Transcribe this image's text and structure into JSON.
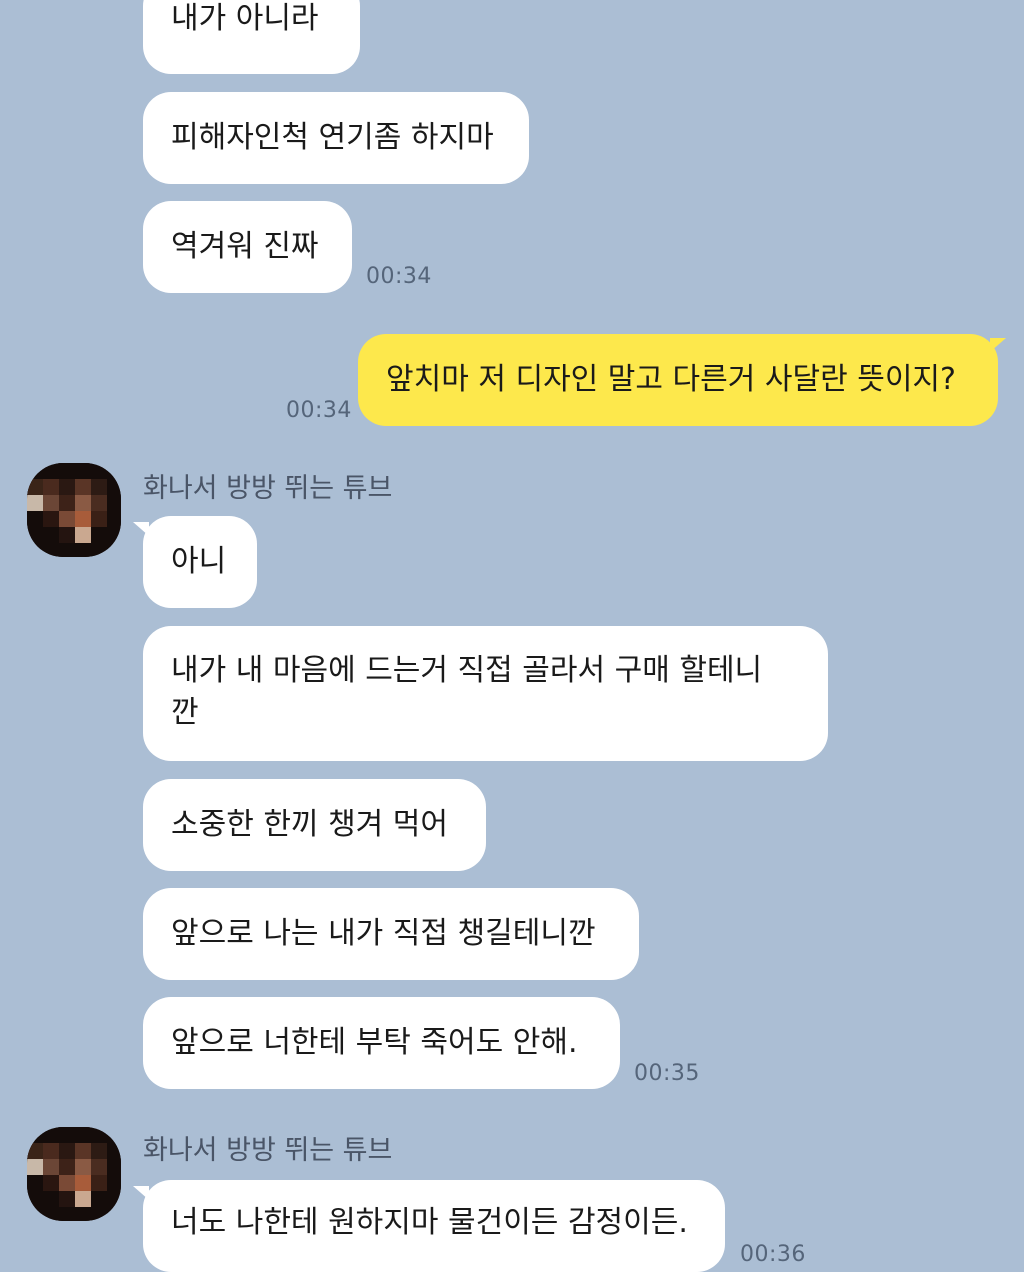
{
  "colors": {
    "background": "#abbed4",
    "incoming_bubble": "#ffffff",
    "outgoing_bubble": "#fde84c",
    "timestamp": "#55657a"
  },
  "messages": {
    "m1": "내가 아니라",
    "m2": "피해자인척 연기좀 하지마",
    "m3": "역겨워 진짜",
    "m3_time": "00:34",
    "m4": "앞치마 저 디자인 말고 다른거 사달란 뜻이지?",
    "m4_time": "00:34",
    "sender1": "화나서 방방 뛰는 튜브",
    "m5": "아니",
    "m6": "내가 내 마음에 드는거 직접 골라서 구매 할테니 깐",
    "m7": "소중한 한끼 챙겨 먹어",
    "m8": "앞으로 나는 내가 직접 챙길테니깐",
    "m9": "앞으로 너한테 부탁 죽어도 안해.",
    "m9_time": "00:35",
    "sender2": "화나서 방방 뛰는 튜브",
    "m10": "너도 나한테 원하지마 물건이든 감정이든.",
    "m10_time": "00:36"
  },
  "icons": {
    "avatar1": "pixelated-profile-photo",
    "avatar2": "pixelated-profile-photo"
  }
}
